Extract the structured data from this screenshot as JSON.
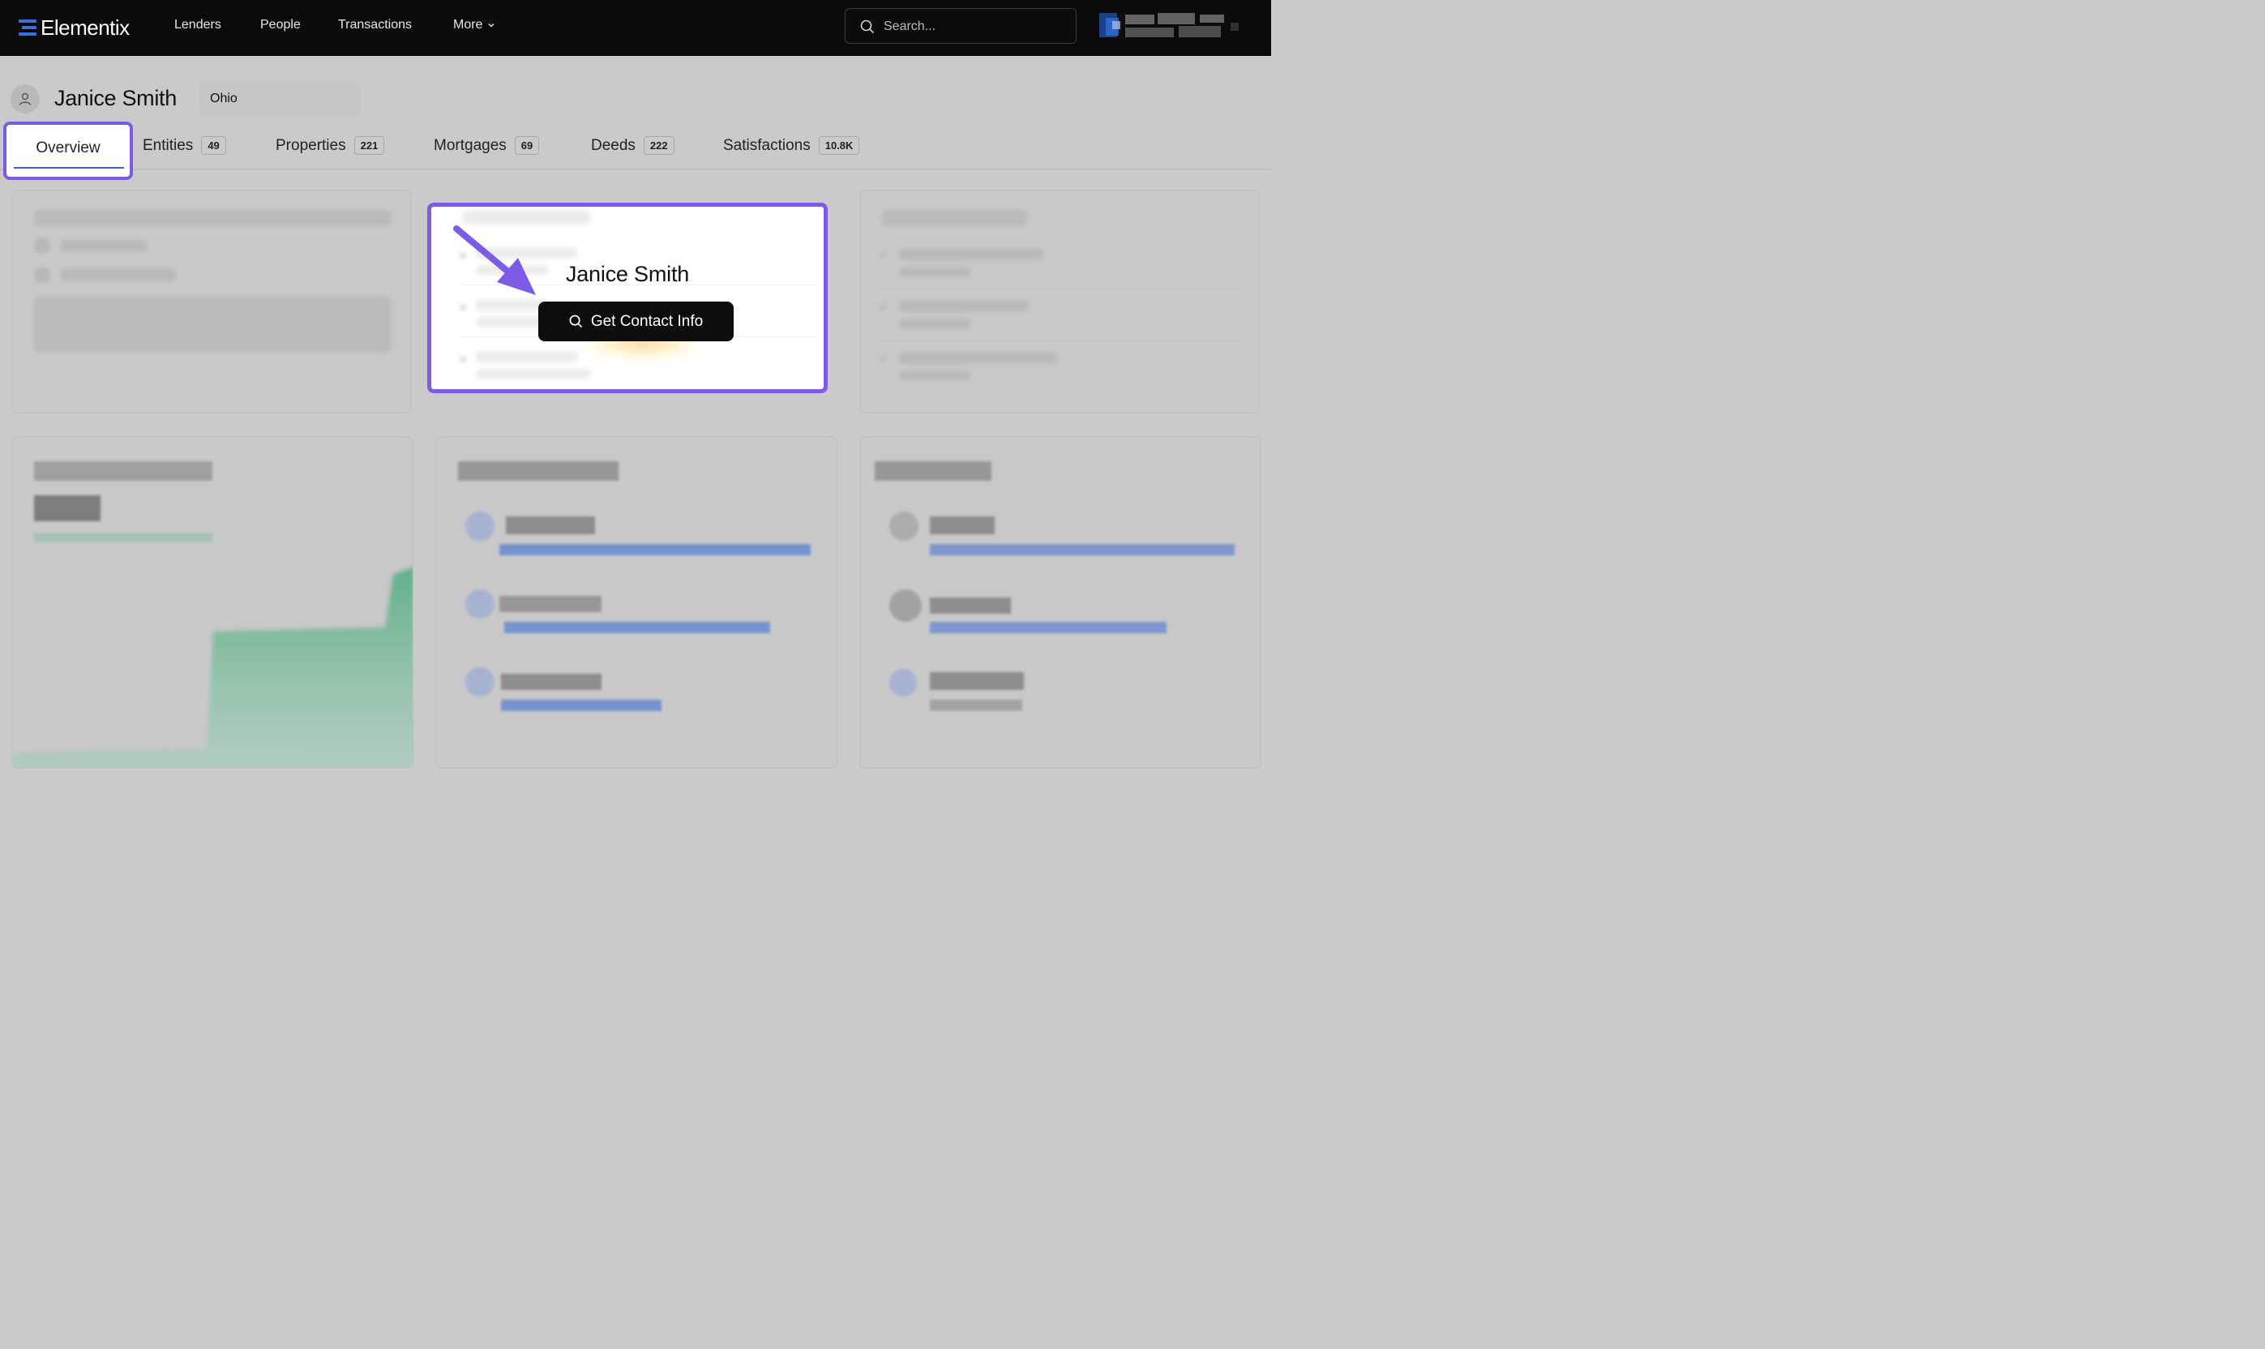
{
  "brand": {
    "name": "Elementix"
  },
  "nav": {
    "links": [
      "Lenders",
      "People",
      "Transactions"
    ],
    "more_label": "More"
  },
  "search": {
    "placeholder": "Search..."
  },
  "profile": {
    "name": "Janice Smith",
    "state": "Ohio"
  },
  "tabs": [
    {
      "label": "Overview",
      "count": ""
    },
    {
      "label": "Entities",
      "count": "49"
    },
    {
      "label": "Properties",
      "count": "221"
    },
    {
      "label": "Mortgages",
      "count": "69"
    },
    {
      "label": "Deeds",
      "count": "222"
    },
    {
      "label": "Satisfactions",
      "count": "10.8K"
    }
  ],
  "contact_card": {
    "name": "Janice Smith",
    "button_label": "Get Contact Info"
  },
  "colors": {
    "highlight": "#7c5ce6",
    "topbar": "#0b0b0c",
    "tab_underline": "#3c5fc9",
    "chart_green": "#3aa57a",
    "link_blue": "#4a78d6"
  },
  "icons": {
    "brand": "elementix-logo-icon",
    "search": "search-icon",
    "more": "chevron-down-icon",
    "avatar": "person-icon",
    "button": "search-icon",
    "callout": "arrow-icon"
  }
}
